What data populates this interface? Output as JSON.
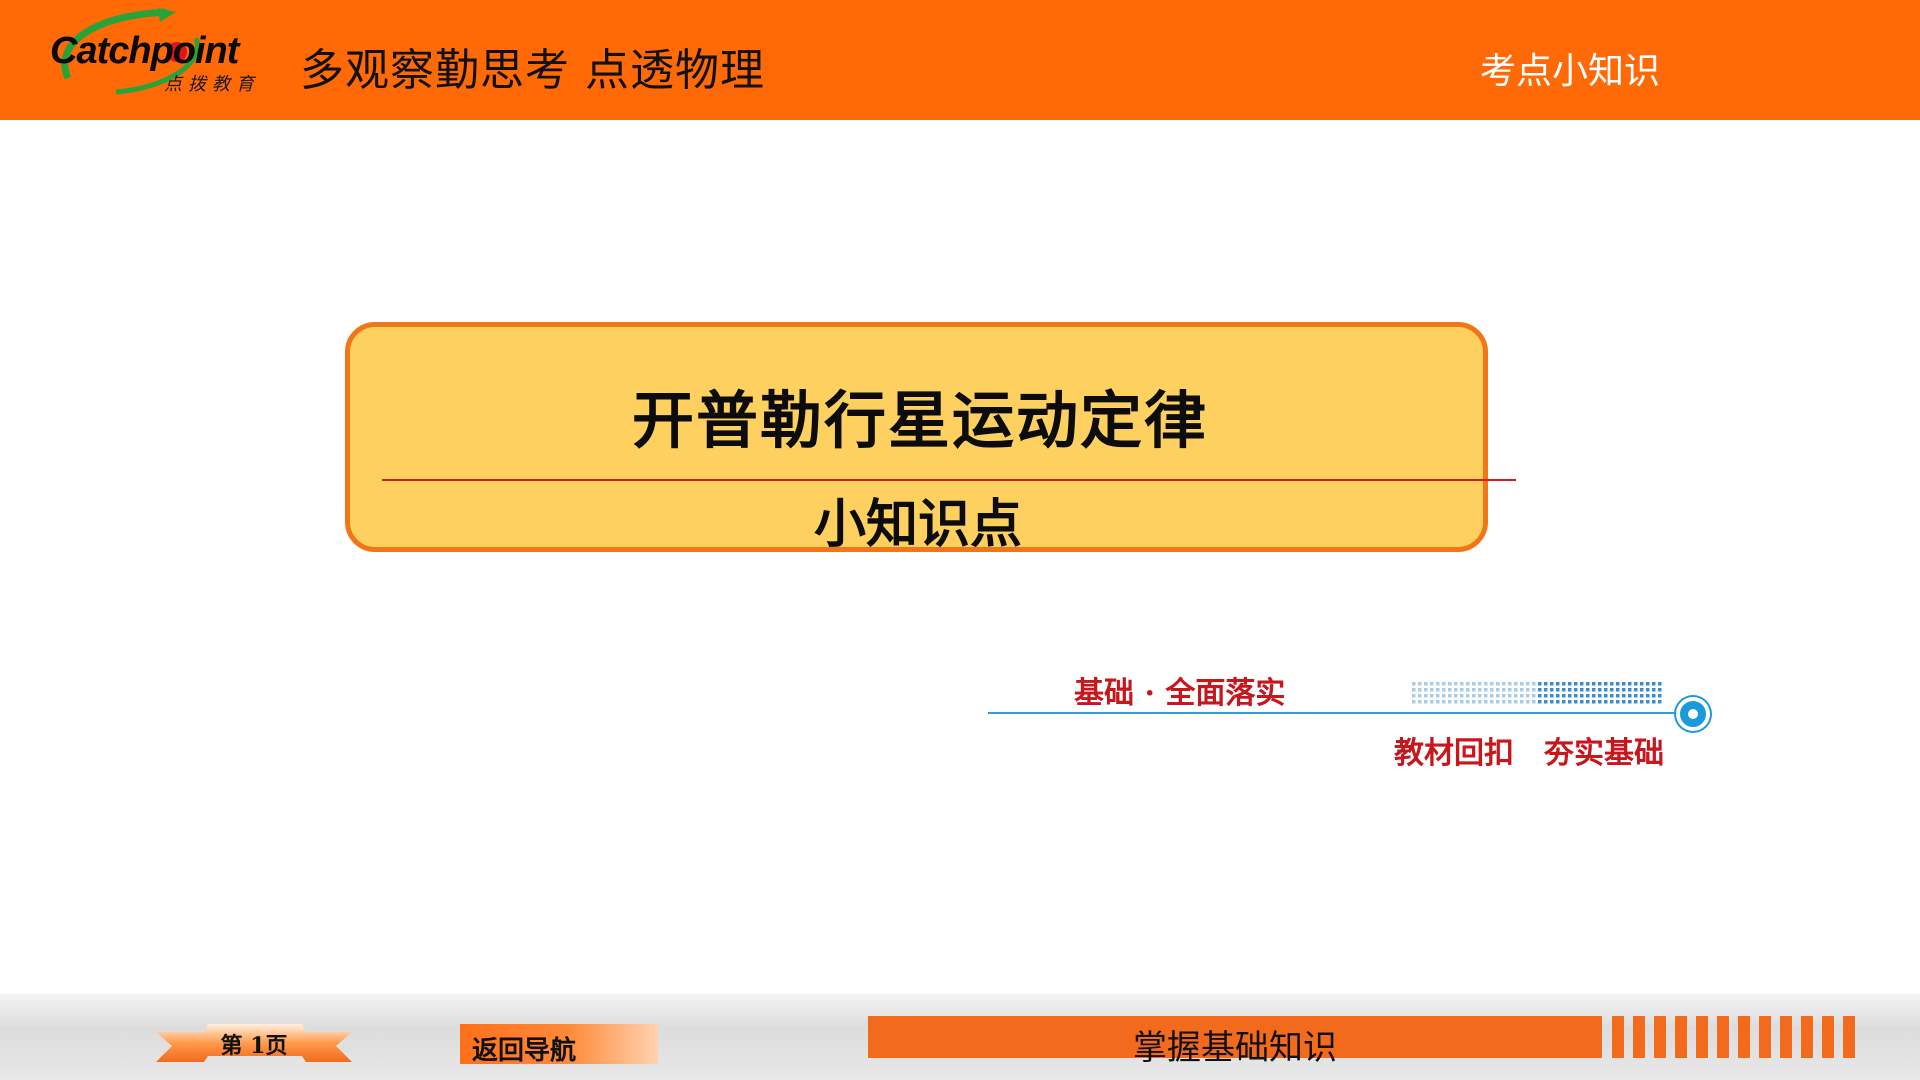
{
  "header": {
    "logo_brand": "Catchpoint",
    "logo_sub": "点拨教育",
    "slogan": "多观察勤思考  点透物理",
    "right_label": "考点小知识"
  },
  "card": {
    "title": "开普勒行星运动定律",
    "subtitle": "小知识点"
  },
  "section": {
    "label": "基础 · 全面落实",
    "tagline_left": "教材回扣",
    "tagline_right": "夯实基础"
  },
  "footer": {
    "page_label": "第 1页",
    "nav_back": "返回导航",
    "bar_label": "掌握基础知识"
  },
  "colors": {
    "header_orange": "#ff6a06",
    "card_fill": "#fdd060",
    "card_border": "#f27618",
    "accent_red": "#c8161d",
    "accent_blue": "#1a9ad8"
  }
}
